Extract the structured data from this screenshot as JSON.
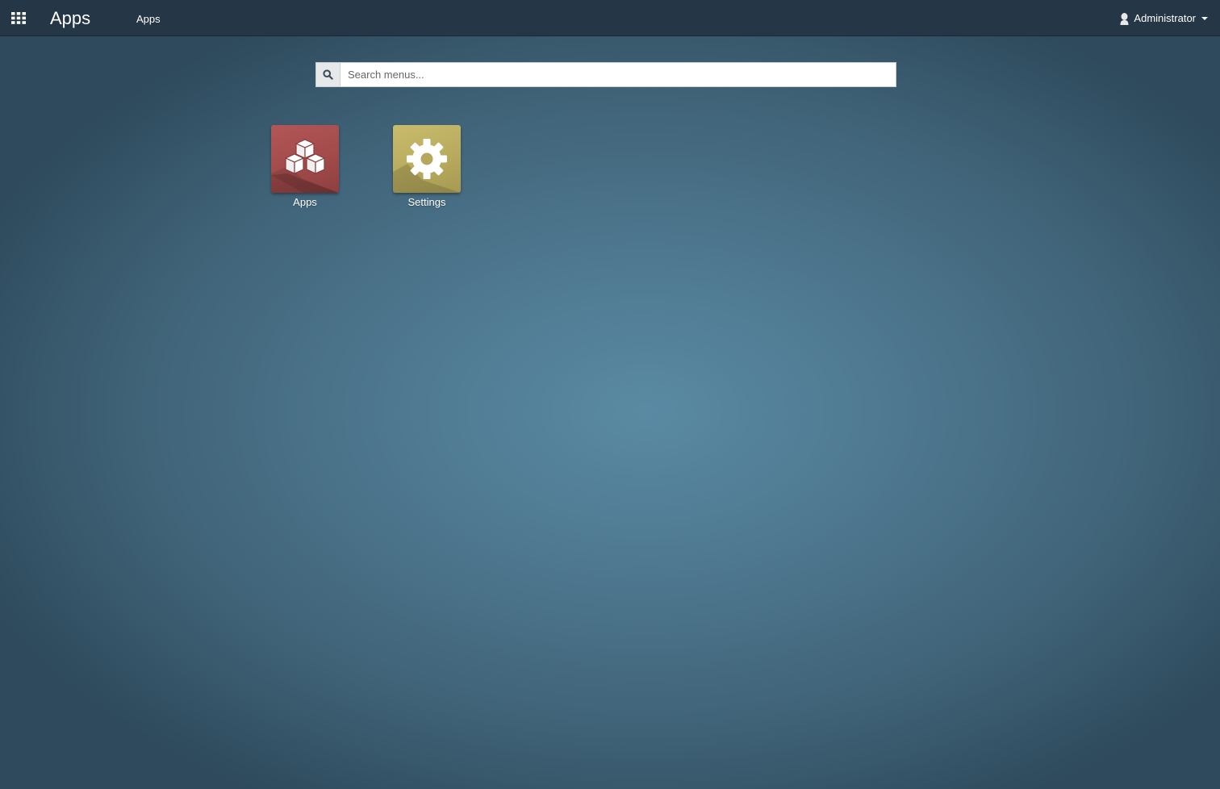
{
  "header": {
    "brand": "Apps",
    "nav_link": "Apps",
    "user_name": "Administrator",
    "menu_icon": "grid-icon",
    "user_icon": "user-icon"
  },
  "search": {
    "placeholder": "Search menus...",
    "value": "",
    "icon": "search-icon"
  },
  "apps": [
    {
      "label": "Apps",
      "icon": "cubes-icon",
      "color": "#a24b4b"
    },
    {
      "label": "Settings",
      "icon": "gear-icon",
      "color": "#b8ab5e"
    }
  ],
  "colors": {
    "topbar": "#253646",
    "background_center": "#5a8aa3",
    "background_edge": "#2e4a5c"
  }
}
